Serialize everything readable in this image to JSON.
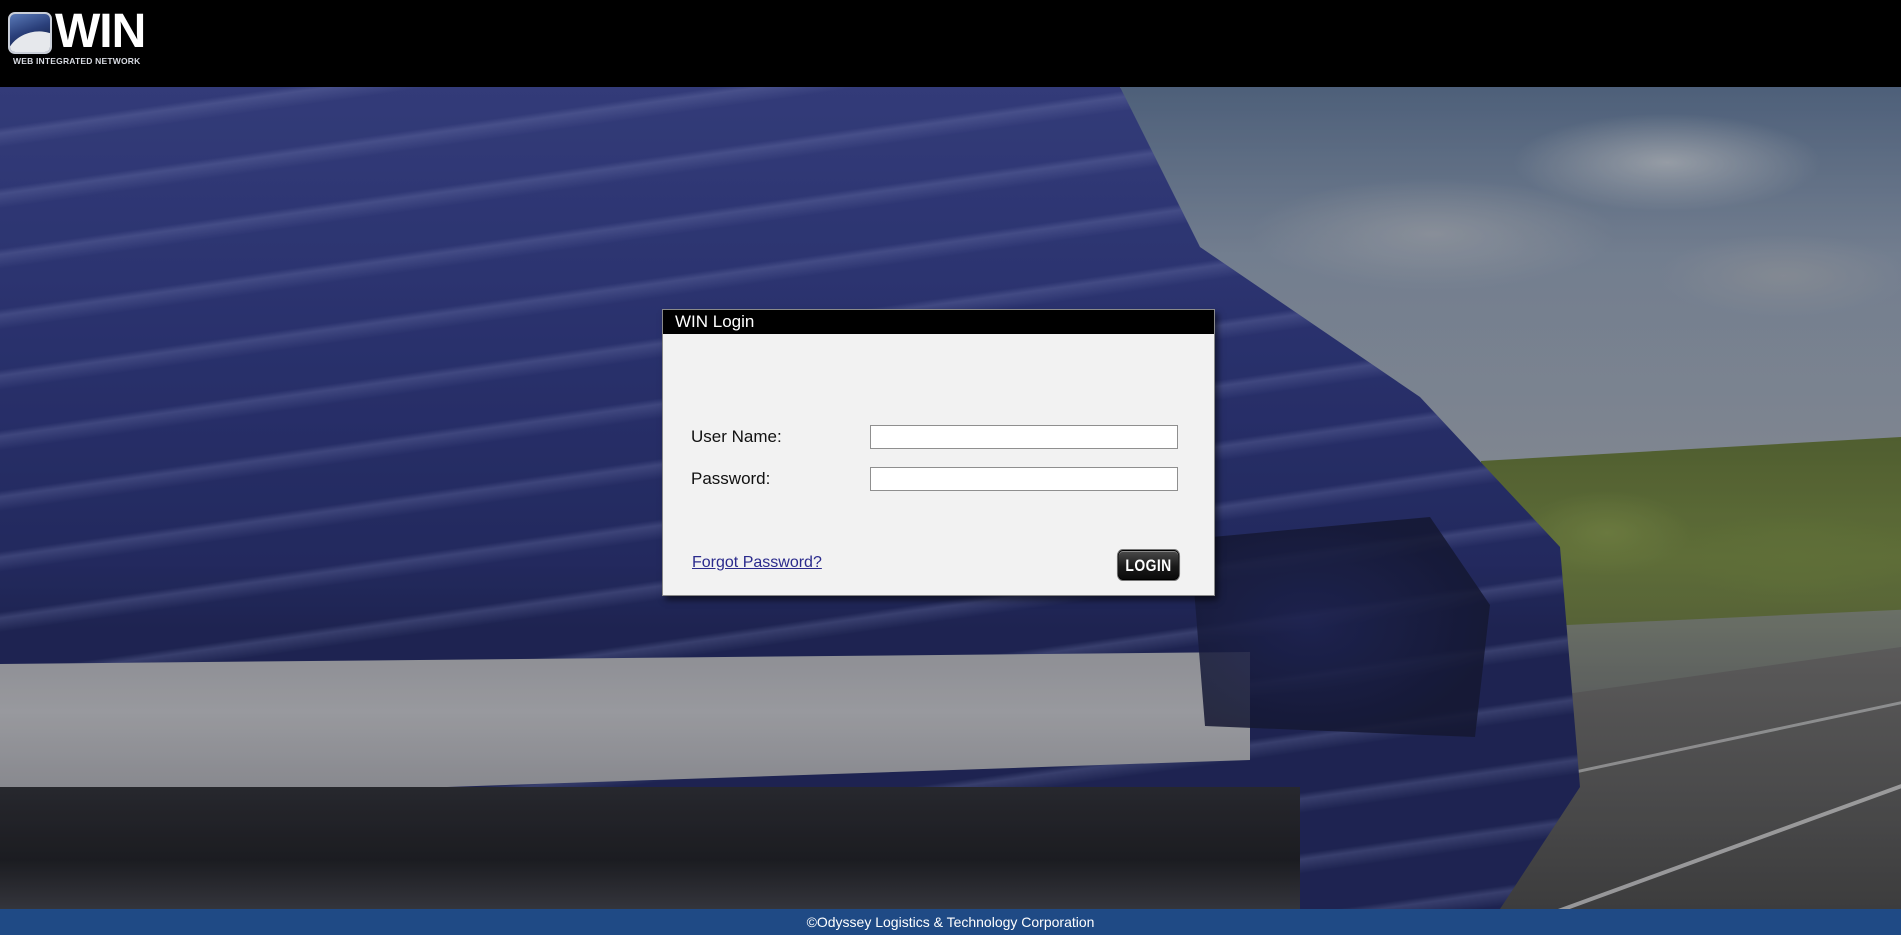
{
  "header": {
    "logo_text": "WIN",
    "logo_subtitle": "WEB INTEGRATED NETWORK"
  },
  "login": {
    "title": "WIN Login",
    "username_label": "User Name:",
    "username_value": "",
    "password_label": "Password:",
    "password_value": "",
    "forgot_password_link": "Forgot Password?",
    "login_button": "LOGIN"
  },
  "footer": {
    "copyright": "©Odyssey Logistics & Technology Corporation"
  },
  "colors": {
    "header_bg": "#000000",
    "footer_bg": "#1f4a85",
    "dialog_bg": "#f2f2f2",
    "link": "#2a2a8c"
  }
}
